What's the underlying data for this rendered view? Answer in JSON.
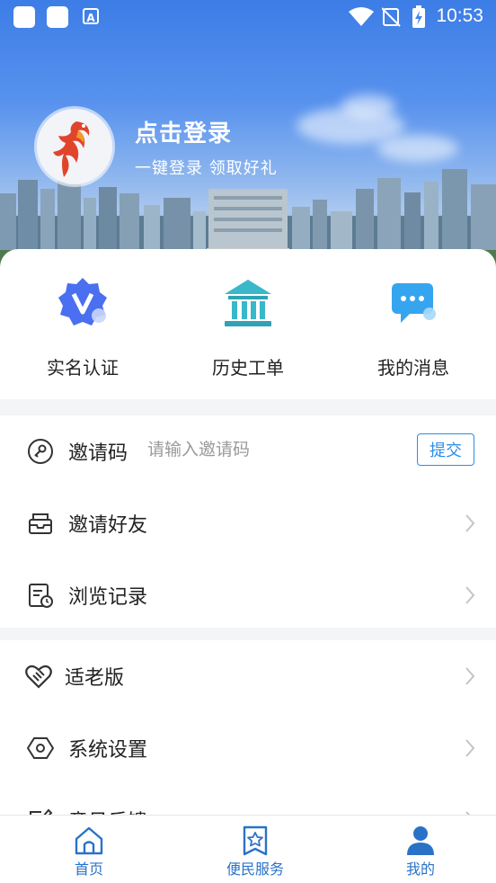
{
  "status_bar": {
    "time": "10:53",
    "icons": [
      "app-square-icon",
      "app-square-icon",
      "font-a-icon",
      "wifi-icon",
      "no-signal-icon",
      "battery-charging-icon"
    ]
  },
  "profile": {
    "login_title": "点击登录",
    "login_subtitle": "一键登录  领取好礼",
    "avatar_icon": "phoenix-logo"
  },
  "quick_actions": [
    {
      "label": "实名认证",
      "icon": "verified-v-icon"
    },
    {
      "label": "历史工单",
      "icon": "building-icon"
    },
    {
      "label": "我的消息",
      "icon": "message-icon"
    }
  ],
  "invite": {
    "label": "邀请码",
    "placeholder": "请输入邀请码",
    "submit_label": "提交",
    "icon": "key-icon"
  },
  "menu_group_1": [
    {
      "label": "邀请好友",
      "icon": "inbox-icon"
    },
    {
      "label": "浏览记录",
      "icon": "history-doc-icon"
    }
  ],
  "menu_group_2": [
    {
      "label": "适老版",
      "icon": "heart-hands-icon"
    },
    {
      "label": "系统设置",
      "icon": "settings-hex-icon"
    },
    {
      "label": "意见反馈",
      "icon": "edit-icon"
    }
  ],
  "tabbar": [
    {
      "label": "首页",
      "icon": "home-icon"
    },
    {
      "label": "便民服务",
      "icon": "service-star-icon"
    },
    {
      "label": "我的",
      "icon": "user-icon",
      "active": true
    }
  ],
  "colors": {
    "accent": "#2a8ee8",
    "tab_active": "#2a72c8",
    "banner_top": "#3c7de6"
  }
}
